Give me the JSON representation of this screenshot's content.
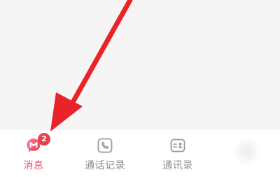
{
  "tab_bar": {
    "tabs": [
      {
        "label": "消息",
        "icon": "message-bubble-icon",
        "badge": "2",
        "active": true,
        "color": "#f05373"
      },
      {
        "label": "通话记录",
        "icon": "call-log-icon",
        "active": false,
        "color": "#8d8d8d"
      },
      {
        "label": "通讯录",
        "icon": "contacts-card-icon",
        "active": false,
        "color": "#8d8d8d"
      }
    ]
  },
  "annotation": {
    "type": "red-arrow",
    "color": "#e8242a",
    "points_to": "消息"
  }
}
